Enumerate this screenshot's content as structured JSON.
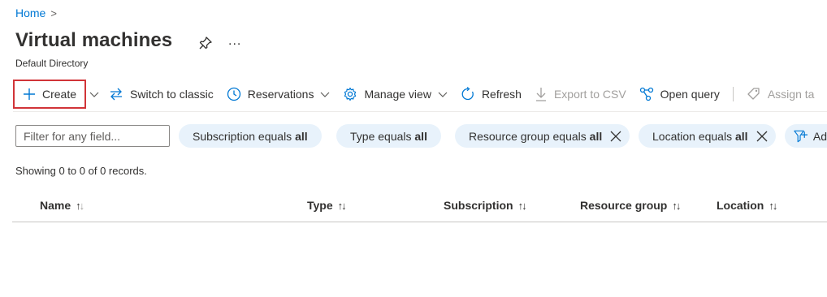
{
  "breadcrumb": {
    "home": "Home",
    "separator": ">"
  },
  "page": {
    "title": "Virtual machines",
    "subtitle": "Default Directory",
    "more": "..."
  },
  "toolbar": {
    "create": "Create",
    "switch_classic": "Switch to classic",
    "reservations": "Reservations",
    "manage_view": "Manage view",
    "refresh": "Refresh",
    "export_csv": "Export to CSV",
    "open_query": "Open query",
    "assign_tags": "Assign ta"
  },
  "filters": {
    "placeholder": "Filter for any field...",
    "pills": [
      {
        "field": "Subscription equals",
        "value": "all"
      },
      {
        "field": "Type equals",
        "value": "all"
      },
      {
        "field": "Resource group equals",
        "value": "all"
      },
      {
        "field": "Location equals",
        "value": "all"
      },
      {
        "field": "Ad",
        "value": ""
      }
    ]
  },
  "records": "Showing 0 to 0 of 0 records.",
  "table": {
    "columns": [
      "Name",
      "Type",
      "Subscription",
      "Resource group",
      "Location"
    ],
    "sort_glyphs": {
      "up": "↑",
      "down": "↓"
    }
  },
  "icons": {
    "accent": "#0078d4",
    "highlight_border": "#d13438"
  }
}
